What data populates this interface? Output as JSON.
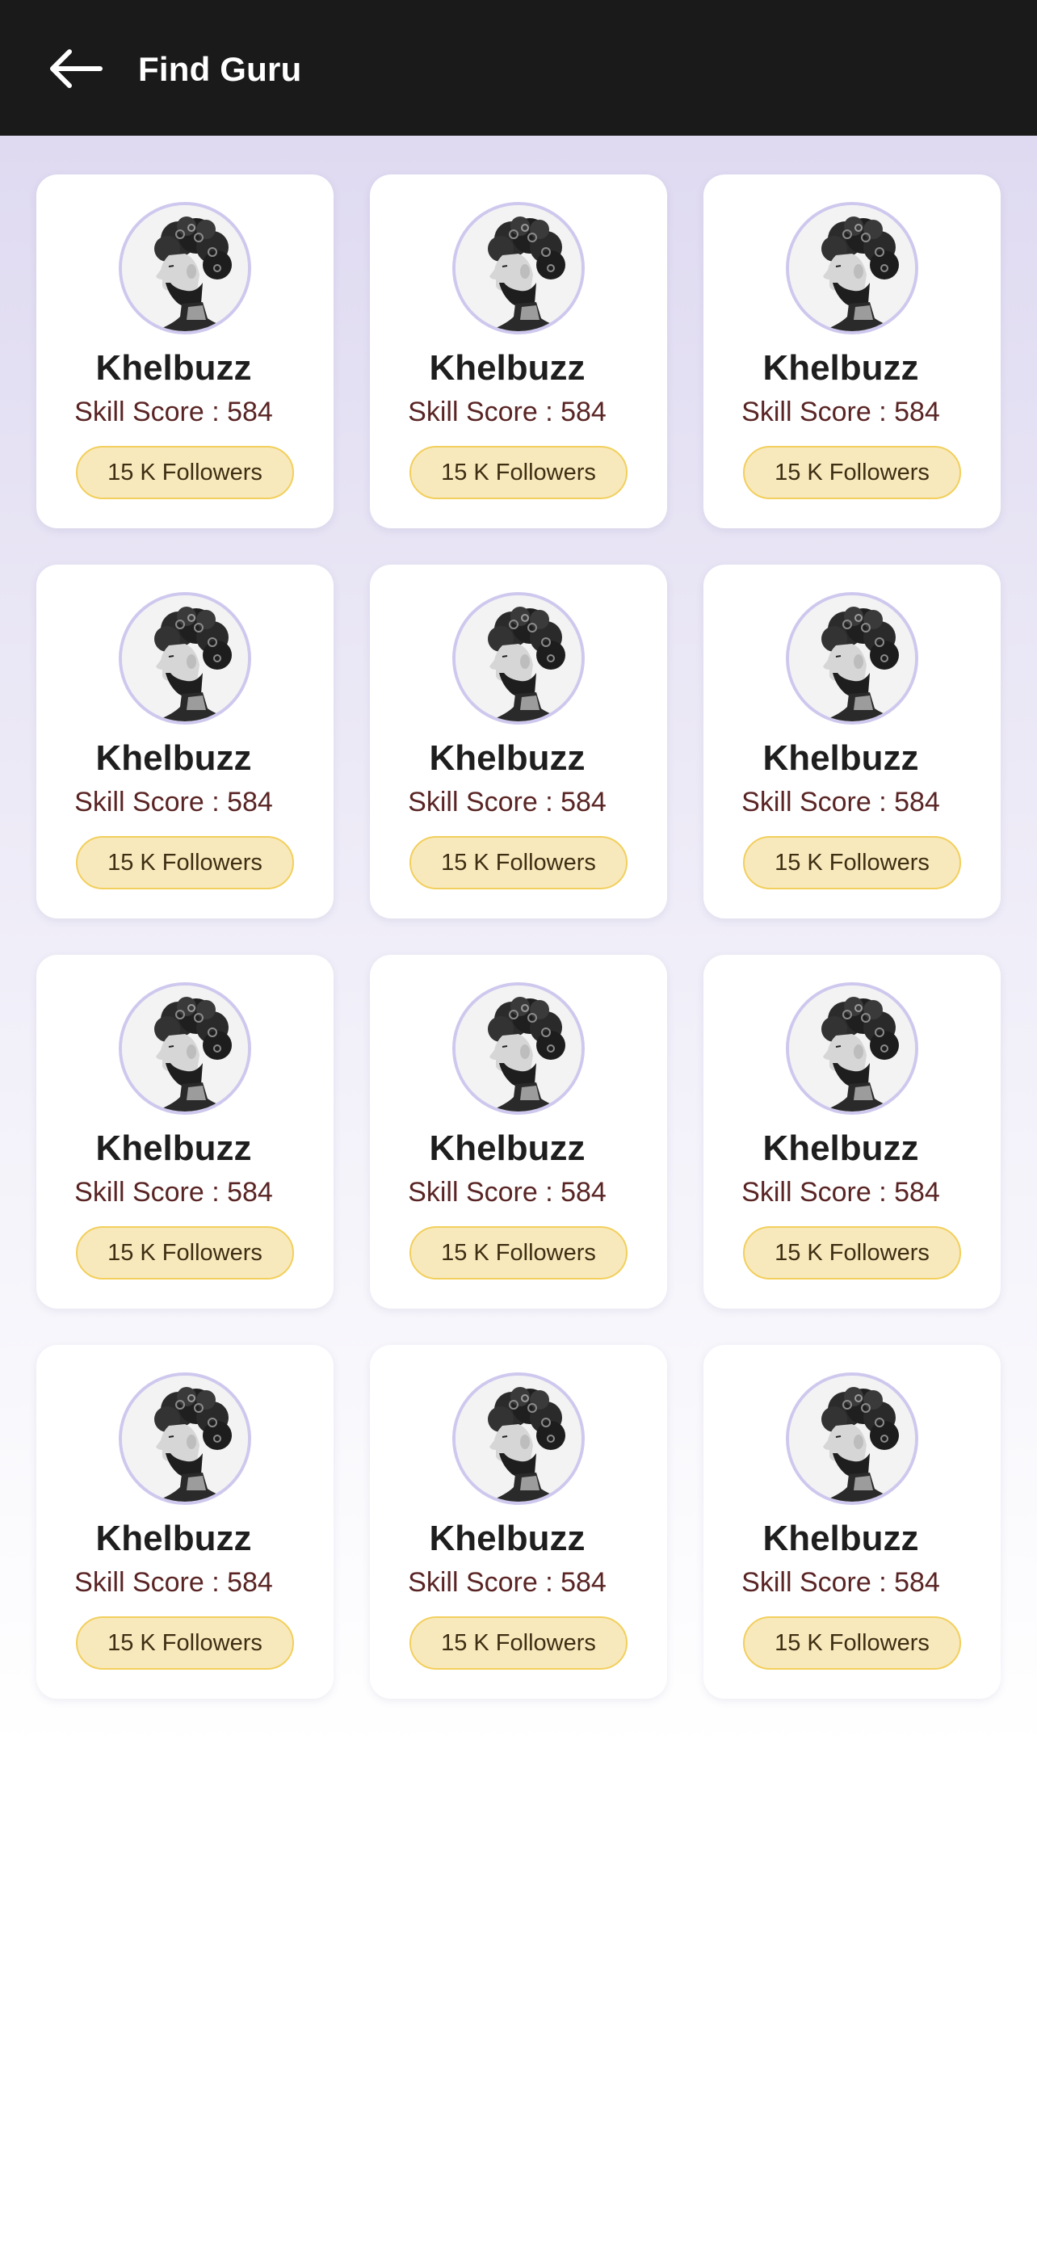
{
  "header": {
    "title": "Find Guru",
    "background": "#1b1a1b",
    "back_icon": "arrow-left-icon"
  },
  "colors": {
    "name": "#1e1e1e",
    "skill_score": "#5a2424",
    "followers_fill": "#f8e9bd",
    "followers_border": "#f2cf5c",
    "avatar_ring": "#cfc8ee"
  },
  "gurus": [
    {
      "name": "Khelbuzz",
      "skill_score": "Skill Score : 584",
      "followers": "15 K Followers"
    },
    {
      "name": "Khelbuzz",
      "skill_score": "Skill Score : 584",
      "followers": "15 K Followers"
    },
    {
      "name": "Khelbuzz",
      "skill_score": "Skill Score : 584",
      "followers": "15 K Followers"
    },
    {
      "name": "Khelbuzz",
      "skill_score": "Skill Score : 584",
      "followers": "15 K Followers"
    },
    {
      "name": "Khelbuzz",
      "skill_score": "Skill Score : 584",
      "followers": "15 K Followers"
    },
    {
      "name": "Khelbuzz",
      "skill_score": "Skill Score : 584",
      "followers": "15 K Followers"
    },
    {
      "name": "Khelbuzz",
      "skill_score": "Skill Score : 584",
      "followers": "15 K Followers"
    },
    {
      "name": "Khelbuzz",
      "skill_score": "Skill Score : 584",
      "followers": "15 K Followers"
    },
    {
      "name": "Khelbuzz",
      "skill_score": "Skill Score : 584",
      "followers": "15 K Followers"
    },
    {
      "name": "Khelbuzz",
      "skill_score": "Skill Score : 584",
      "followers": "15 K Followers"
    },
    {
      "name": "Khelbuzz",
      "skill_score": "Skill Score : 584",
      "followers": "15 K Followers"
    },
    {
      "name": "Khelbuzz",
      "skill_score": "Skill Score : 584",
      "followers": "15 K Followers"
    }
  ]
}
